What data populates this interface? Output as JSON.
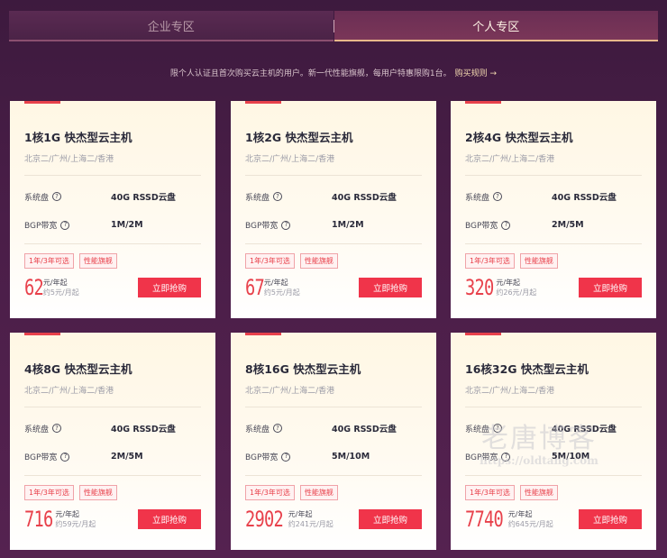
{
  "tabs": [
    {
      "label": "企业专区",
      "active": false
    },
    {
      "label": "个人专区",
      "active": true
    }
  ],
  "notice": {
    "text": "限个人认证且首次购买云主机的用户。新一代性能旗舰，每用户特惠限购1台。",
    "rule_link": "购买规则 →"
  },
  "spec_labels": {
    "disk": "系统盘",
    "bandwidth": "BGP带宽"
  },
  "help_icon": "question-circle-icon",
  "accent_color": "#e8414b",
  "products": [
    {
      "title": "1核1G 快杰型云主机",
      "regions": "北京二/广州/上海二/香港",
      "disk": "40G RSSD云盘",
      "bandwidth": "1M/2M",
      "tags": [
        "1年/3年可选",
        "性能旗舰"
      ],
      "price": "62",
      "unit": "元/年起",
      "approx": "约5元/月起",
      "buy": "立即抢购"
    },
    {
      "title": "1核2G 快杰型云主机",
      "regions": "北京二/广州/上海二/香港",
      "disk": "40G RSSD云盘",
      "bandwidth": "1M/2M",
      "tags": [
        "1年/3年可选",
        "性能旗舰"
      ],
      "price": "67",
      "unit": "元/年起",
      "approx": "约5元/月起",
      "buy": "立即抢购"
    },
    {
      "title": "2核4G 快杰型云主机",
      "regions": "北京二/广州/上海二/香港",
      "disk": "40G RSSD云盘",
      "bandwidth": "2M/5M",
      "tags": [
        "1年/3年可选",
        "性能旗舰"
      ],
      "price": "320",
      "unit": "元/年起",
      "approx": "约26元/月起",
      "buy": "立即抢购"
    },
    {
      "title": "4核8G 快杰型云主机",
      "regions": "北京二/广州/上海二/香港",
      "disk": "40G RSSD云盘",
      "bandwidth": "2M/5M",
      "tags": [
        "1年/3年可选",
        "性能旗舰"
      ],
      "price": "716",
      "unit": "元/年起",
      "approx": "约59元/月起",
      "buy": "立即抢购"
    },
    {
      "title": "8核16G 快杰型云主机",
      "regions": "北京二/广州/上海二/香港",
      "disk": "40G RSSD云盘",
      "bandwidth": "5M/10M",
      "tags": [
        "1年/3年可选",
        "性能旗舰"
      ],
      "price": "2902",
      "unit": "元/年起",
      "approx": "约241元/月起",
      "buy": "立即抢购"
    },
    {
      "title": "16核32G 快杰型云主机",
      "regions": "北京二/广州/上海二/香港",
      "disk": "40G RSSD云盘",
      "bandwidth": "5M/10M",
      "tags": [
        "1年/3年可选",
        "性能旗舰"
      ],
      "price": "7740",
      "unit": "元/年起",
      "approx": "约645元/月起",
      "buy": "立即抢购"
    }
  ],
  "watermark": {
    "main": "老唐博客",
    "url": "https://oldtang.com"
  }
}
